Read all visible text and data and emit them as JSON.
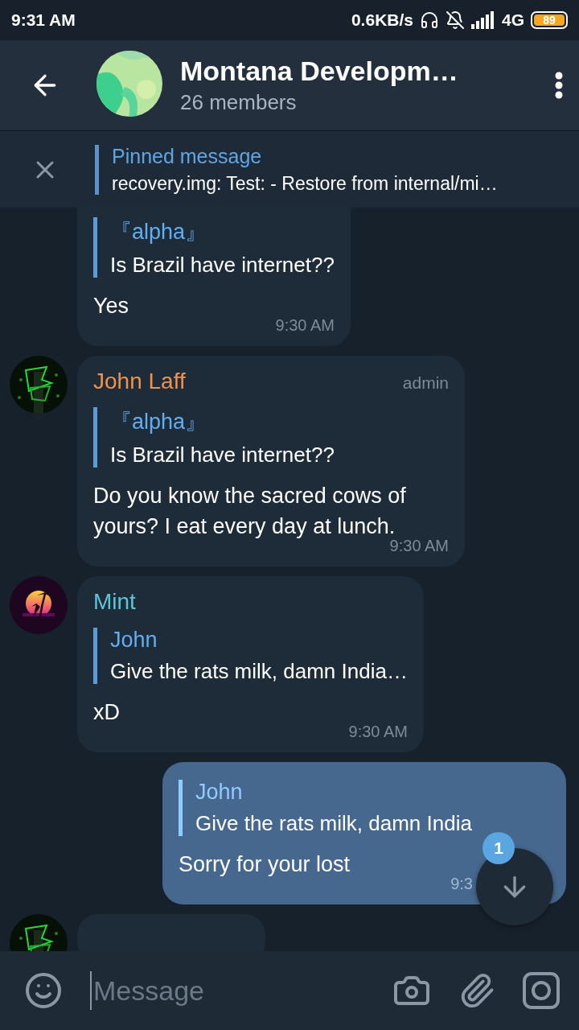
{
  "status_bar": {
    "time": "9:31 AM",
    "speed": "0.6KB/s",
    "network": "4G",
    "battery": "89"
  },
  "header": {
    "title": "Montana Developm…",
    "subtitle": "26 members"
  },
  "pinned": {
    "label": "Pinned message",
    "text": "recovery.img: Test: - Restore from internal/mi…"
  },
  "messages": [
    {
      "kind": "incoming",
      "cut_top": true,
      "reply": {
        "name": "『alpha』",
        "text": "Is Brazil have internet??"
      },
      "text": "Yes",
      "time": "9:30 AM"
    },
    {
      "kind": "incoming",
      "name": "John Laff",
      "color": "#f0924f",
      "role": "admin",
      "reply": {
        "name": "『alpha』",
        "text": "Is Brazil have internet??"
      },
      "text": "Do you know the sacred cows of yours? I eat every day at lunch.",
      "time": "9:30 AM"
    },
    {
      "kind": "incoming",
      "name": "Mint",
      "color": "#5ec5d8",
      "reply": {
        "name": "John",
        "text": "Give the rats milk, damn India…"
      },
      "text": "xD",
      "time": "9:30 AM"
    },
    {
      "kind": "outgoing",
      "reply": {
        "name": "John",
        "text": "Give the rats milk, damn India"
      },
      "text": "Sorry for your lost",
      "time": "9:3"
    },
    {
      "kind": "incoming"
    }
  ],
  "scroll_button": {
    "badge": "1"
  },
  "composer": {
    "placeholder": "Message"
  }
}
